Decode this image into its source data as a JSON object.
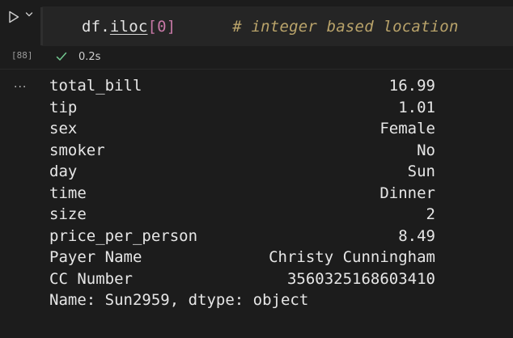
{
  "cell": {
    "execution_count": "[88]",
    "code": {
      "object": "df",
      "dot": ".",
      "attribute": "iloc",
      "open_bracket": "[",
      "index": "0",
      "close_bracket": "]",
      "spacing": "      ",
      "comment": "# integer based location"
    },
    "status": {
      "duration": "0.2s"
    }
  },
  "output": {
    "ellipsis": "...",
    "rows": [
      {
        "key": "total_bill",
        "value": "16.99"
      },
      {
        "key": "tip",
        "value": "1.01"
      },
      {
        "key": "sex",
        "value": "Female"
      },
      {
        "key": "smoker",
        "value": "No"
      },
      {
        "key": "day",
        "value": "Sun"
      },
      {
        "key": "time",
        "value": "Dinner"
      },
      {
        "key": "size",
        "value": "2"
      },
      {
        "key": "price_per_person",
        "value": "8.49"
      },
      {
        "key": "Payer Name",
        "value": "Christy Cunningham"
      },
      {
        "key": "CC Number",
        "value": "3560325168603410"
      }
    ],
    "footer": "Name: Sun2959, dtype: object"
  },
  "colors": {
    "background": "#1c1c1c",
    "editor_background": "#252525",
    "comment": "#b9a36a",
    "number": "#c778a6",
    "success_check": "#73c991"
  },
  "icons": {
    "run": "play-icon",
    "run_menu": "chevron-down-icon",
    "status": "check-icon"
  }
}
